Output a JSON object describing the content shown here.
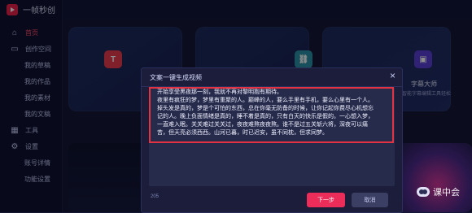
{
  "app": {
    "name": "一帧秒创",
    "accent": "#e7224b"
  },
  "sidebar": {
    "items": [
      {
        "label": "首页",
        "icon": "home-icon",
        "active": true
      },
      {
        "label": "创作空间",
        "icon": "monitor-icon"
      },
      {
        "label": "我的草稿"
      },
      {
        "label": "我的作品"
      },
      {
        "label": "我的素材"
      },
      {
        "label": "我的文稿"
      },
      {
        "label": "工具",
        "icon": "toolbox-icon"
      },
      {
        "label": "设置",
        "icon": "settings-icon"
      },
      {
        "label": "账号详情"
      },
      {
        "label": "功能设置"
      }
    ]
  },
  "cards": {
    "third_title": "字幕大师",
    "third_subtitle": "使用智能字幕编辑工具轻松"
  },
  "modal": {
    "title": "文案一键生成视频",
    "text": [
      "开始享受黑夜那一刻，我就不再对黎明抱有期待。",
      "夜里有疯狂的梦，梦里有重聚的人。巅峰的人，要么手里有手机，要么心里有一个人。",
      "掉头发是真的，梦是个可怕的东西，总在你毫无防备的时候，让你记起你费尽心机想忘",
      "记的人。晚上负面情绪是真的，睡不着是真的，只有白天的快乐是假的。一心想入梦，",
      "一直难入眠。关关难过关关过，夜夜难熬夜夜熬。谁不是过五关斩六将，深夜可以痛",
      "苦，但天亮必须西西。山河已暮，时已迟安，虽不同枕，但求同梦。"
    ],
    "counter": "205",
    "next_label": "下一步",
    "cancel_label": "取消",
    "highlight_color": "#e33343"
  },
  "watermark": {
    "label": "课中会"
  }
}
